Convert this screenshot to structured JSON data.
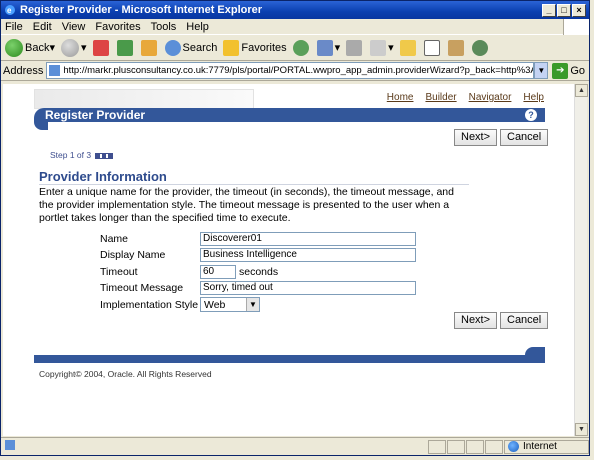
{
  "window": {
    "title": "Register Provider - Microsoft Internet Explorer"
  },
  "menu": [
    "File",
    "Edit",
    "View",
    "Favorites",
    "Tools",
    "Help"
  ],
  "toolbar": {
    "back": "Back",
    "search": "Search",
    "favorites": "Favorites"
  },
  "address": {
    "label": "Address",
    "url": "http://markr.plusconsultancy.co.uk:7779/pls/portal/PORTAL.wwpro_app_admin.providerWizard?p_back=http%3A%2F%2Fmarkr.plusconsultancy.co..",
    "go": "Go"
  },
  "portal": {
    "links": [
      "Home",
      "Builder",
      "Navigator",
      "Help"
    ],
    "header": "Register Provider",
    "next_label": "Next>",
    "cancel_label": "Cancel",
    "step": "Step 1 of 3",
    "section_title": "Provider Information",
    "description": "Enter a unique name for the provider, the timeout (in seconds), the timeout message, and the provider implementation style. The timeout message is presented to the user when a portlet takes longer than the specified time to execute.",
    "form": {
      "name_label": "Name",
      "name_value": "Discoverer01",
      "display_label": "Display Name",
      "display_value": "Business Intelligence",
      "timeout_label": "Timeout",
      "timeout_value": "60",
      "timeout_unit": "seconds",
      "message_label": "Timeout Message",
      "message_value": "Sorry, timed out",
      "style_label": "Implementation Style",
      "style_value": "Web"
    },
    "copyright": "Copyright© 2004, Oracle. All Rights Reserved"
  },
  "status": {
    "zone": "Internet"
  }
}
